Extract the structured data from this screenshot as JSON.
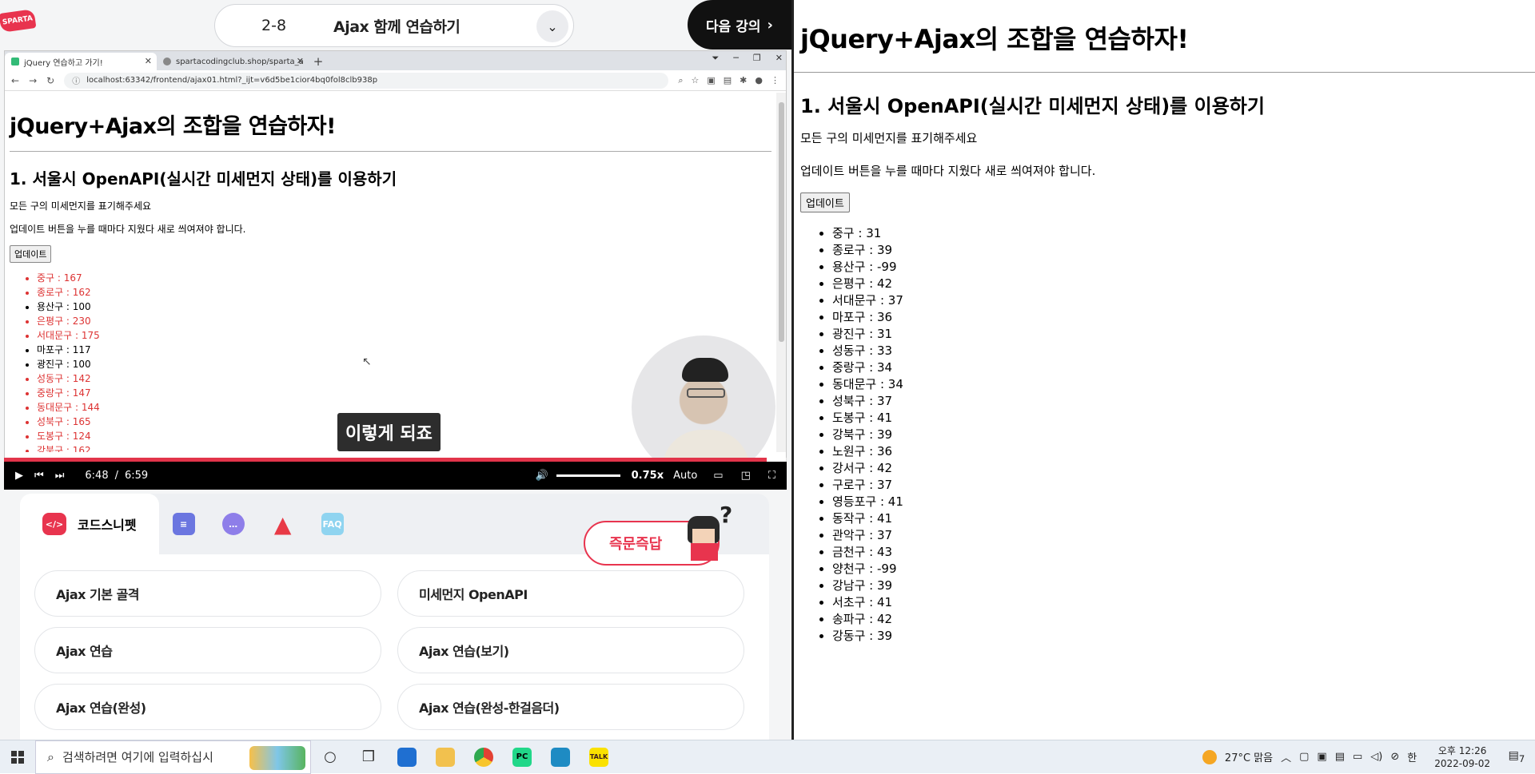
{
  "lecture": {
    "logo_text": "SPARTA",
    "lesson_number": "2-8",
    "lesson_title": "Ajax 함께 연습하기",
    "next_label": "다음 강의",
    "caption": "이렇게 되죠"
  },
  "browser": {
    "tabs": [
      {
        "label": "jQuery 연습하고 가기!"
      },
      {
        "label": "spartacodingclub.shop/sparta_a"
      }
    ],
    "url": "localhost:63342/frontend/ajax01.html?_ijt=v6d5be1cior4bq0fol8clb938p"
  },
  "embedded_page": {
    "title": "jQuery+Ajax의 조합을 연습하자!",
    "subtitle": "1. 서울시 OpenAPI(실시간 미세먼지 상태)를 이용하기",
    "desc1": "모든 구의 미세먼지를 표기해주세요",
    "desc2": "업데이트 버튼을 누를 때마다 지웠다 새로 씌여져야 합니다.",
    "button": "업데이트",
    "items": [
      {
        "text": "중구 : 167",
        "bad": true
      },
      {
        "text": "종로구 : 162",
        "bad": true
      },
      {
        "text": "용산구 : 100",
        "bad": false
      },
      {
        "text": "은평구 : 230",
        "bad": true
      },
      {
        "text": "서대문구 : 175",
        "bad": true
      },
      {
        "text": "마포구 : 117",
        "bad": false
      },
      {
        "text": "광진구 : 100",
        "bad": false
      },
      {
        "text": "성동구 : 142",
        "bad": true
      },
      {
        "text": "중랑구 : 147",
        "bad": true
      },
      {
        "text": "동대문구 : 144",
        "bad": true
      },
      {
        "text": "성북구 : 165",
        "bad": true
      },
      {
        "text": "도봉구 : 124",
        "bad": true
      },
      {
        "text": "강북구 : 162",
        "bad": true
      }
    ]
  },
  "player": {
    "current_time": "6:48",
    "separator": "/",
    "duration": "6:59",
    "progress": 0.974,
    "rate": "0.75x",
    "quality": "Auto"
  },
  "panel": {
    "active_tab": "코드스니펫",
    "code_icon_text": "</>",
    "faq_label": "FAQ",
    "quick_answer": "즉문즉답",
    "snippets": [
      "Ajax 기본 골격",
      "미세먼지 OpenAPI",
      "Ajax 연습",
      "Ajax 연습(보기)",
      "Ajax 연습(완성)",
      "Ajax 연습(완성-한걸음더)"
    ]
  },
  "right_page": {
    "title": "jQuery+Ajax의 조합을 연습하자!",
    "subtitle": "1. 서울시 OpenAPI(실시간 미세먼지 상태)를 이용하기",
    "desc1": "모든 구의 미세먼지를 표기해주세요",
    "desc2": "업데이트 버튼을 누를 때마다 지웠다 새로 씌여져야 합니다.",
    "button": "업데이트",
    "items": [
      "중구 : 31",
      "종로구 : 39",
      "용산구 : -99",
      "은평구 : 42",
      "서대문구 : 37",
      "마포구 : 36",
      "광진구 : 31",
      "성동구 : 33",
      "중랑구 : 34",
      "동대문구 : 34",
      "성북구 : 37",
      "도봉구 : 41",
      "강북구 : 39",
      "노원구 : 36",
      "강서구 : 42",
      "구로구 : 37",
      "영등포구 : 41",
      "동작구 : 41",
      "관악구 : 37",
      "금천구 : 43",
      "양천구 : -99",
      "강남구 : 39",
      "서초구 : 41",
      "송파구 : 42",
      "강동구 : 39"
    ]
  },
  "taskbar": {
    "search_placeholder": "검색하려면 여기에 입력하십시",
    "weather": "27°C 맑음",
    "ime": "한",
    "time_period": "오후 12:26",
    "date": "2022-09-02",
    "notification_count": "7",
    "kakao_label": "TALK",
    "pycharm_label": "PC"
  },
  "colors": {
    "accent": "#e8344e",
    "bad_value": "#dd3333",
    "player_bg": "#000000"
  }
}
